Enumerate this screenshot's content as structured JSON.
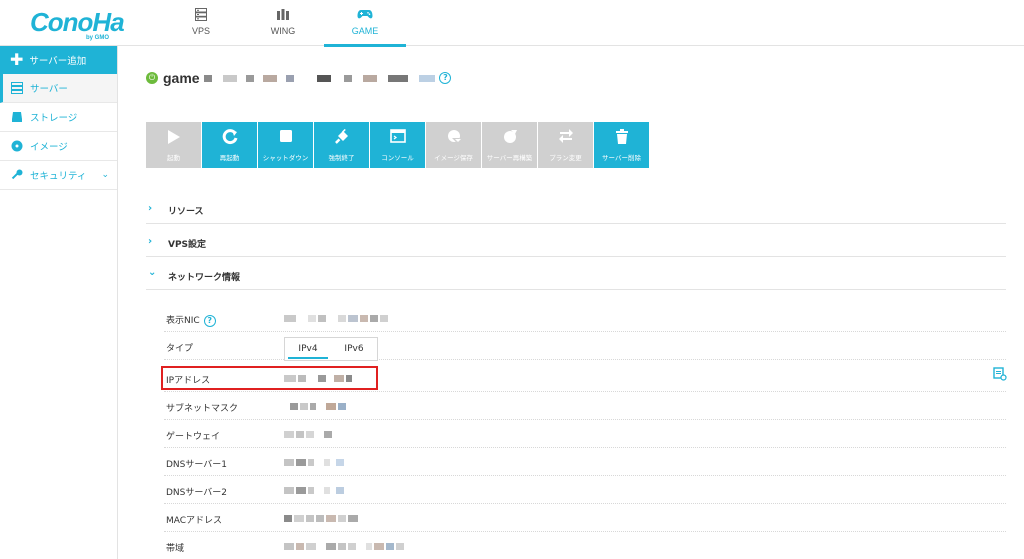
{
  "brand": {
    "logo_text": "ConoHa",
    "logo_sub": "by GMO",
    "accent": "#1fb3d6"
  },
  "topnav": [
    {
      "label": "VPS",
      "icon": "server-icon"
    },
    {
      "label": "WING",
      "icon": "wing-icon"
    },
    {
      "label": "GAME",
      "icon": "gamepad-icon",
      "active": true
    }
  ],
  "sidebar": {
    "add_label": "サーバー追加",
    "items": [
      {
        "label": "サーバー",
        "icon": "server-icon",
        "active": true
      },
      {
        "label": "ストレージ",
        "icon": "storage-icon"
      },
      {
        "label": "イメージ",
        "icon": "image-icon"
      },
      {
        "label": "セキュリティ",
        "icon": "key-icon",
        "expandable": true
      }
    ]
  },
  "server": {
    "name_prefix": "game",
    "status_color": "#6dbb3c"
  },
  "actions": [
    {
      "label": "起動",
      "enabled": false
    },
    {
      "label": "再起動",
      "enabled": true
    },
    {
      "label": "シャットダウン",
      "enabled": true
    },
    {
      "label": "強制終了",
      "enabled": true
    },
    {
      "label": "コンソール",
      "enabled": true
    },
    {
      "label": "イメージ保存",
      "enabled": false
    },
    {
      "label": "サーバー再構築",
      "enabled": false
    },
    {
      "label": "プラン変更",
      "enabled": false
    },
    {
      "label": "サーバー削除",
      "enabled": true
    }
  ],
  "sections": [
    {
      "label": "リソース",
      "expanded": false
    },
    {
      "label": "VPS設定",
      "expanded": false
    },
    {
      "label": "ネットワーク情報",
      "expanded": true
    }
  ],
  "network": {
    "rows": [
      {
        "label": "表示NIC"
      },
      {
        "label": "タイプ"
      },
      {
        "label": "IPアドレス"
      },
      {
        "label": "サブネットマスク"
      },
      {
        "label": "ゲートウェイ"
      },
      {
        "label": "DNSサーバー1"
      },
      {
        "label": "DNSサーバー2"
      },
      {
        "label": "MACアドレス"
      },
      {
        "label": "帯域"
      }
    ],
    "type_options": [
      "IPv4",
      "IPv6"
    ],
    "type_selected": "IPv4"
  },
  "highlight_color": "#e02020"
}
